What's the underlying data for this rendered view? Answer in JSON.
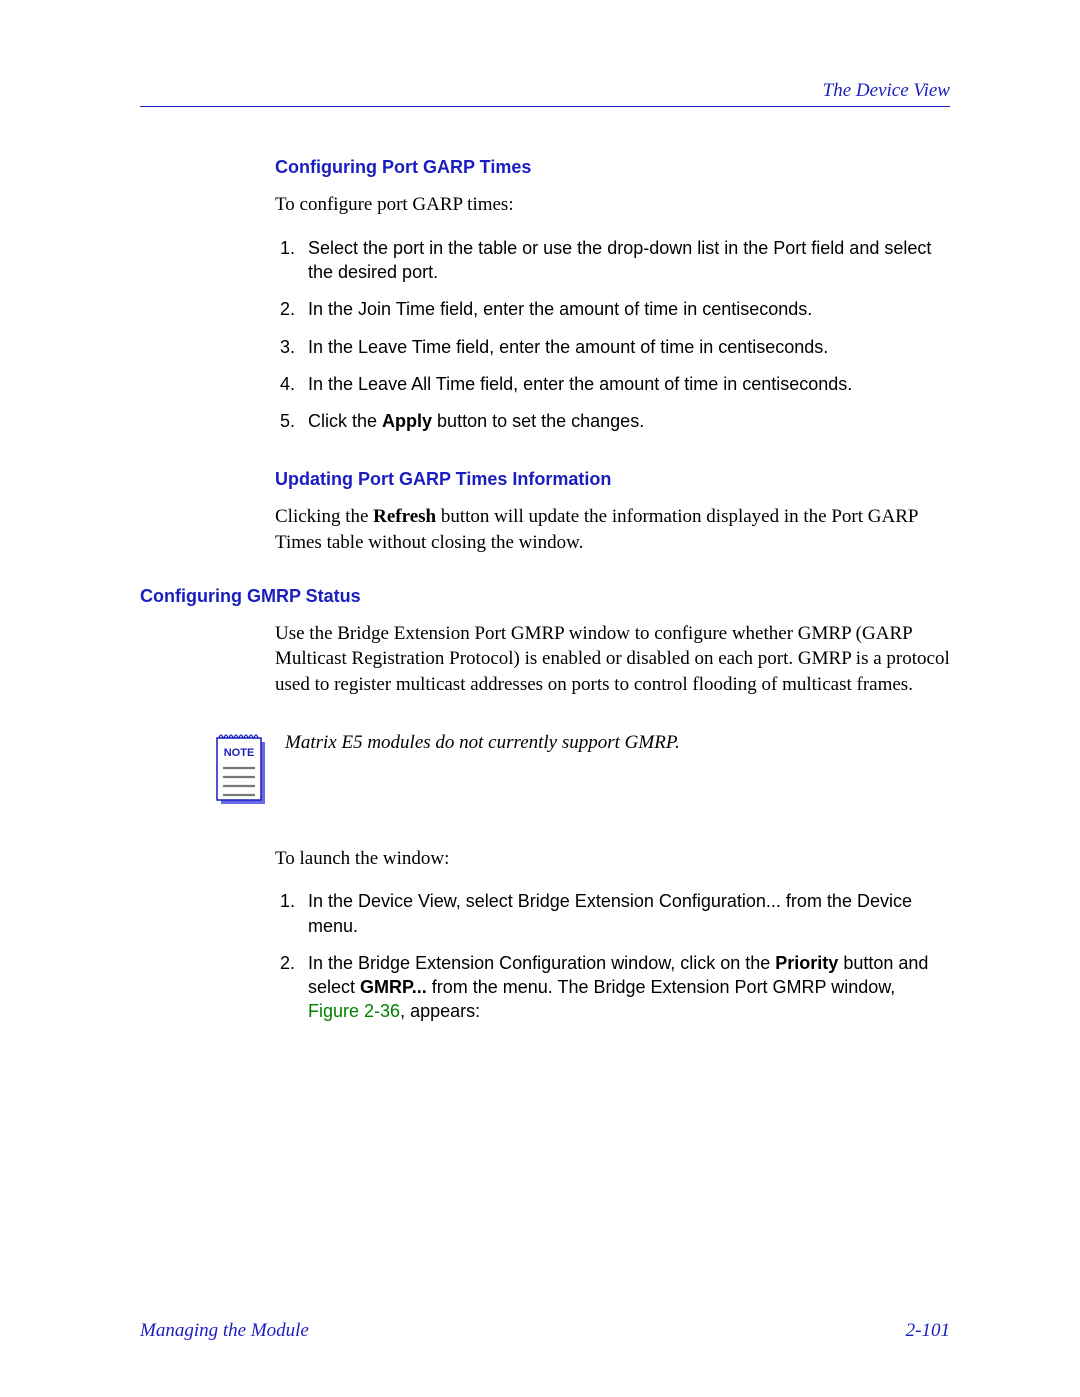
{
  "header": {
    "title": "The Device View"
  },
  "section1": {
    "heading": "Configuring Port GARP Times",
    "intro": "To configure port GARP times:",
    "steps": [
      {
        "text": "Select the port in the table or use the drop-down list in the Port field and select the desired port."
      },
      {
        "text": "In the Join Time field, enter the amount of time in centiseconds."
      },
      {
        "text": "In the Leave Time field, enter the amount of time in centiseconds."
      },
      {
        "text": "In the Leave All Time field, enter the amount of time in centiseconds."
      },
      {
        "pre": "Click the ",
        "bold": "Apply",
        "post": " button to set the changes."
      }
    ]
  },
  "section2": {
    "heading": "Updating Port GARP Times Information",
    "para_pre": "Clicking the ",
    "para_bold": "Refresh",
    "para_post": " button will update the information displayed in the Port GARP Times table without closing the window."
  },
  "section3": {
    "heading": "Configuring GMRP Status",
    "para": "Use the Bridge Extension Port GMRP window to configure whether GMRP (GARP Multicast Registration Protocol) is enabled or disabled on each port. GMRP is a protocol used to register multicast addresses on ports to control flooding of multicast frames.",
    "note_label": "NOTE",
    "note_text": "Matrix E5 modules do not currently support GMRP.",
    "launch_intro": "To launch the window:",
    "launch_steps": [
      {
        "text": "In the Device View, select Bridge Extension Configuration... from the Device menu."
      },
      {
        "pre": "In the Bridge Extension Configuration window, click on the ",
        "bold1": "Priority",
        "mid1": " button and select ",
        "bold2": "GMRP...",
        "mid2": " from the menu. The Bridge Extension Port GMRP window, ",
        "fig": "Figure 2-36",
        "post": ", appears:"
      }
    ]
  },
  "footer": {
    "left": "Managing the Module",
    "right": "2-101"
  }
}
